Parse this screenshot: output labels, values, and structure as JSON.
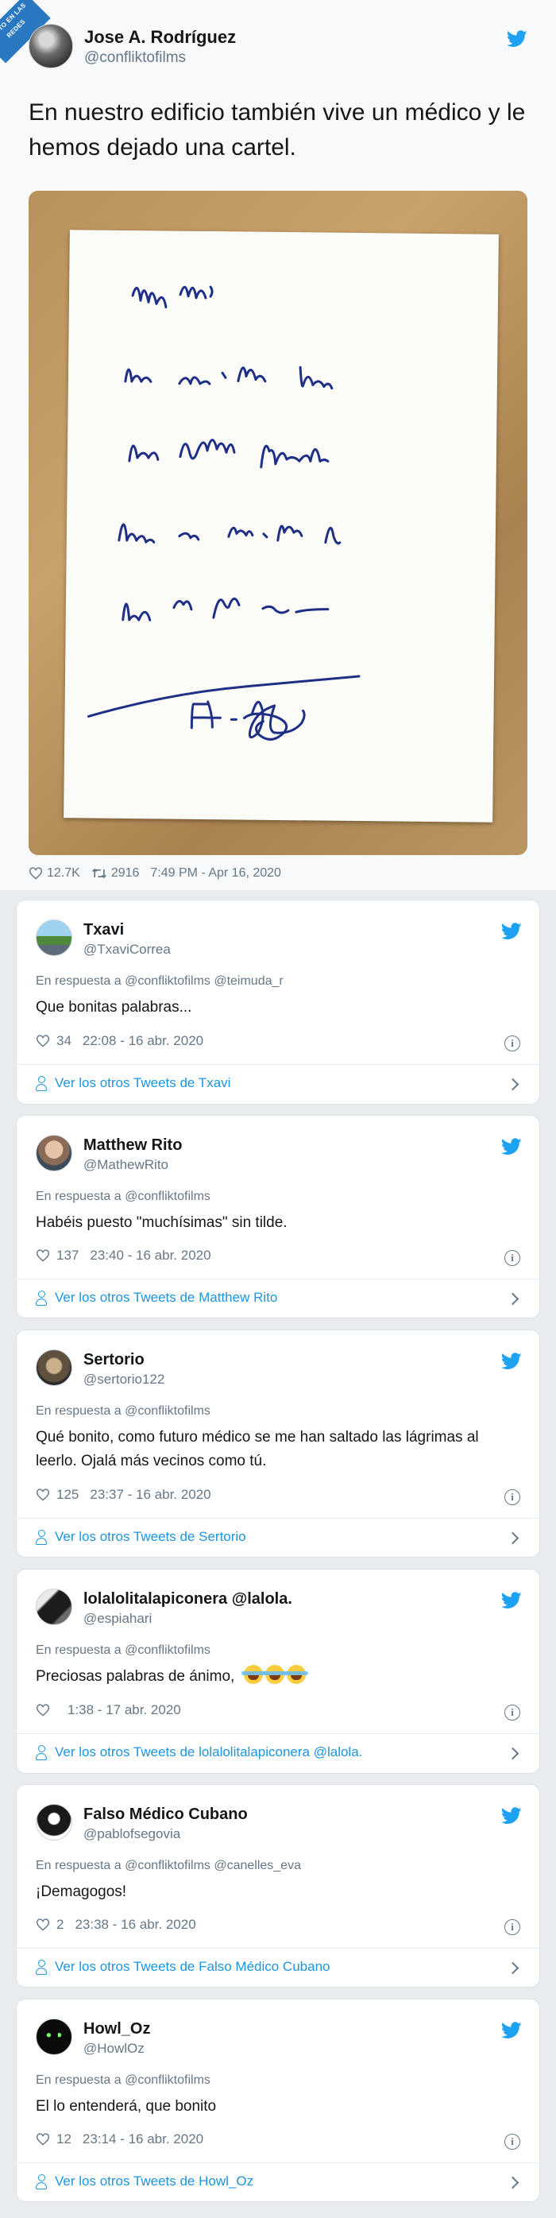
{
  "watermark": "VISTO EN LAS REDES",
  "main_tweet": {
    "name": "Jose A. Rodríguez",
    "handle": "@confliktofilms",
    "text": "En nuestro edificio también vive un médico y le hemos dejado una cartel.",
    "likes": "12.7K",
    "retweets": "2916",
    "timestamp": "7:49 PM - Apr 16, 2020"
  },
  "replies": [
    {
      "name": "Txavi",
      "handle": "@TxaviCorrea",
      "reply_to": "En respuesta a @confliktofilms @teimuda_r",
      "text": "Que bonitas palabras...",
      "likes": "34",
      "time": "22:08 - 16 abr. 2020",
      "more": "Ver los otros Tweets de Txavi"
    },
    {
      "name": "Matthew Rito",
      "handle": "@MathewRito",
      "reply_to": "En respuesta a @confliktofilms",
      "text": "Habéis puesto \"muchísimas\" sin tilde.",
      "likes": "137",
      "time": "23:40 - 16 abr. 2020",
      "more": "Ver los otros Tweets de Matthew Rito"
    },
    {
      "name": "Sertorio",
      "handle": "@sertorio122",
      "reply_to": "En respuesta a @confliktofilms",
      "text": "Qué bonito, como futuro médico se me han saltado las lágrimas al leerlo. Ojalá más vecinos como tú.",
      "likes": "125",
      "time": "23:37 - 16 abr. 2020",
      "more": "Ver los otros Tweets de Sertorio"
    },
    {
      "name": "lolalolitalapiconera @lalola.",
      "handle": "@espiahari",
      "reply_to": "En respuesta a @confliktofilms",
      "text": "Preciosas palabras de ánimo,",
      "likes": "",
      "time": "1:38 - 17 abr. 2020",
      "more": "Ver los otros Tweets de lolalolitalapiconera @lalola."
    },
    {
      "name": "Falso Médico Cubano",
      "handle": "@pablofsegovia",
      "reply_to": "En respuesta a @confliktofilms @canelles_eva",
      "text": "¡Demagogos!",
      "likes": "2",
      "time": "23:38 - 16 abr. 2020",
      "more": "Ver los otros Tweets de Falso Médico Cubano"
    },
    {
      "name": "Howl_Oz",
      "handle": "@HowlOz",
      "reply_to": "En respuesta a @confliktofilms",
      "text": "El lo entenderá, que bonito",
      "likes": "12",
      "time": "23:14 - 16 abr. 2020",
      "more": "Ver los otros Tweets de Howl_Oz"
    }
  ],
  "colors": {
    "twitter_blue": "#1da1f2",
    "link_blue": "#1b95e0",
    "muted": "#657786"
  },
  "icons": [
    "twitter-bird-icon",
    "heart-icon",
    "retweet-icon",
    "info-icon",
    "person-icon",
    "chevron-right-icon",
    "laughing-emoji-icon"
  ]
}
